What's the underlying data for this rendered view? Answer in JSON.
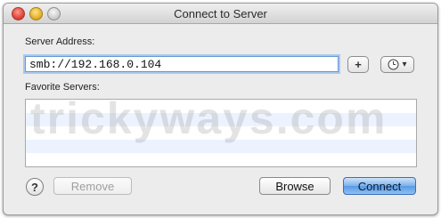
{
  "window": {
    "title": "Connect to Server"
  },
  "server_address": {
    "label": "Server Address:",
    "value": "smb://192.168.0.104"
  },
  "buttons": {
    "add": "+",
    "recent_menu": "▾",
    "help": "?",
    "remove": "Remove",
    "browse": "Browse",
    "connect": "Connect"
  },
  "favorites": {
    "label": "Favorite Servers:",
    "items": []
  },
  "watermark": "trickyways.com",
  "colors": {
    "accent": "#5a9ae3",
    "focus_ring": "#a9c8ee",
    "list_alt_row": "#edf3fe"
  },
  "icons": {
    "close": "traffic-light-close",
    "minimize": "traffic-light-minimize",
    "zoom": "traffic-light-zoom",
    "recent": "clock-icon",
    "help": "question-icon"
  }
}
